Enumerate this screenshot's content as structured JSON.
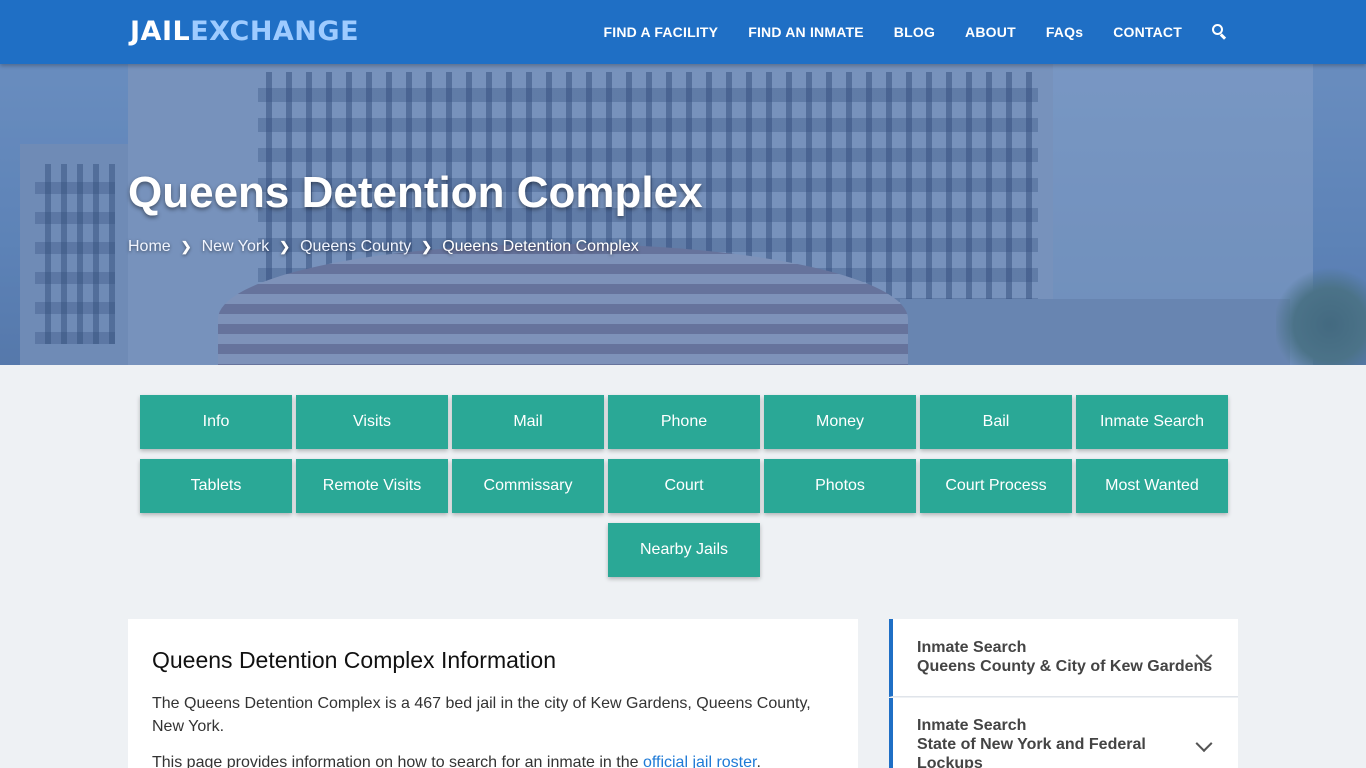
{
  "brand": {
    "part1": "JAIL",
    "part2": "EXCHANGE"
  },
  "nav": {
    "items": [
      {
        "label": "FIND A FACILITY"
      },
      {
        "label": "FIND AN INMATE"
      },
      {
        "label": "BLOG"
      },
      {
        "label": "ABOUT"
      },
      {
        "label": "FAQs"
      },
      {
        "label": "CONTACT"
      }
    ],
    "search_icon": "search-icon"
  },
  "hero": {
    "title": "Queens Detention Complex",
    "breadcrumb": [
      "Home",
      "New York",
      "Queens County",
      "Queens Detention Complex"
    ]
  },
  "tiles": {
    "row1": [
      "Info",
      "Visits",
      "Mail",
      "Phone",
      "Money",
      "Bail",
      "Inmate Search"
    ],
    "row2": [
      "Tablets",
      "Remote Visits",
      "Commissary",
      "Court",
      "Photos",
      "Court Process",
      "Most Wanted"
    ],
    "row3": [
      "Nearby Jails"
    ]
  },
  "info": {
    "heading": "Queens Detention Complex Information",
    "para1": "The Queens Detention Complex is a 467 bed jail in the city of Kew Gardens, Queens County, New York.",
    "para2_prefix": "This page provides information on how to search for an inmate in the ",
    "para2_link": "official jail roster",
    "para2_suffix": "."
  },
  "sidebar": {
    "items": [
      {
        "line1": "Inmate Search",
        "line2": "Queens County & City of Kew Gardens"
      },
      {
        "line1": "Inmate Search",
        "line2": "State of New York and Federal",
        "line3": "Lockups"
      }
    ]
  },
  "colors": {
    "header": "#1f6fc5",
    "tile": "#2aa896",
    "link": "#1f7ad6",
    "logo_accent": "#9ecbff"
  }
}
